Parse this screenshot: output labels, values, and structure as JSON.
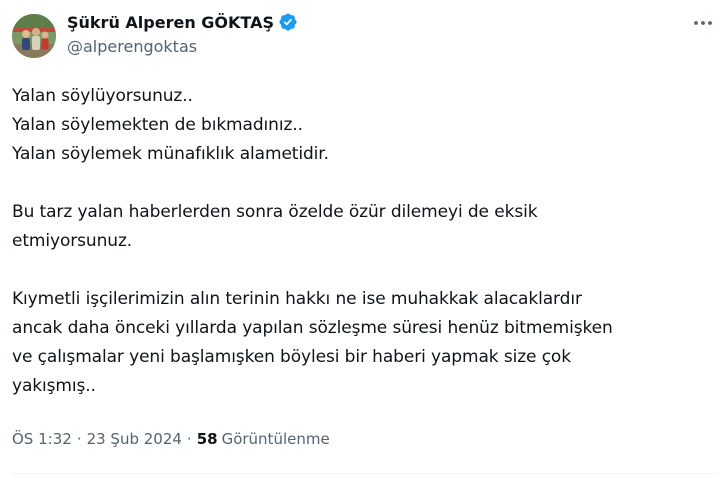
{
  "author": {
    "display_name": "Şükrü Alperen GÖKTAŞ",
    "handle": "@alperengoktas",
    "verified_icon": "verified-badge-icon",
    "verified_color": "#1d9bf0"
  },
  "tweet": {
    "paragraphs": [
      [
        "Yalan söylüyorsunuz..",
        "Yalan söylemekten de bıkmadınız..",
        "Yalan söylemek münafıklık alametidir."
      ],
      [
        "Bu tarz yalan haberlerden sonra özelde özür dilemeyi de eksik",
        "etmiyorsunuz."
      ],
      [
        "Kıymetli işçilerimizin alın terinin hakkı ne ise muhakkak alacaklardır",
        "ancak daha önceki yıllarda yapılan sözleşme süresi henüz bitmemişken",
        "ve çalışmalar yeni başlamışken böylesi bir haberi yapmak size çok",
        "yakışmış.."
      ]
    ]
  },
  "meta": {
    "time": "ÖS 1:32",
    "separator": "·",
    "date": "23 Şub 2024",
    "views_count": "58",
    "views_label": "Görüntülenme"
  },
  "colors": {
    "text": "#0f1419",
    "secondary": "#536471",
    "divider": "#eff3f4"
  },
  "icons": {
    "more": "more-dots-icon"
  }
}
